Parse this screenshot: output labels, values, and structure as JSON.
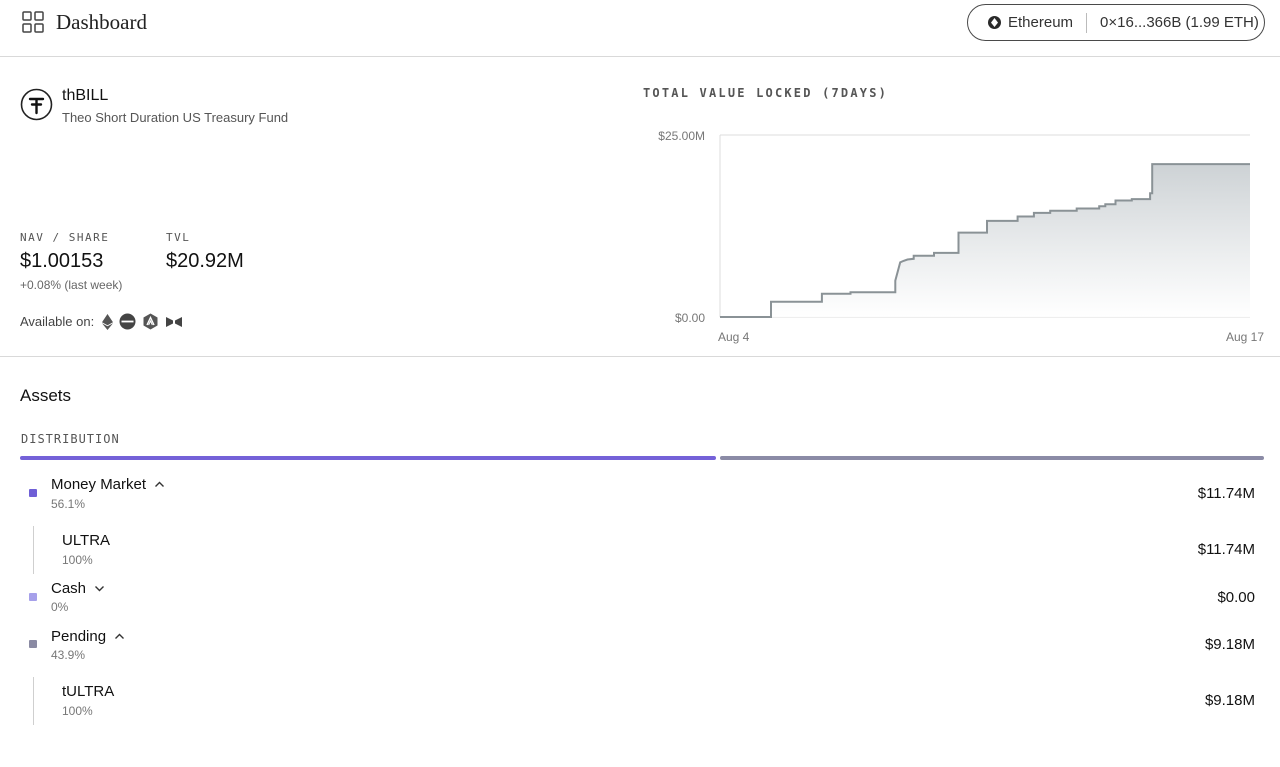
{
  "header": {
    "title": "Dashboard",
    "network": "Ethereum",
    "address": "0×16...366B (1.99 ETH)"
  },
  "fund": {
    "symbol": "thBILL",
    "name": "Theo Short Duration US Treasury Fund",
    "nav_label": "NAV / SHARE",
    "nav_value": "$1.00153",
    "nav_change": "+0.08% (last week)",
    "tvl_label": "TVL",
    "tvl_value": "$20.92M",
    "available_label": "Available on:",
    "available_icons": [
      "ethereum-icon",
      "chain-icon-circle",
      "arbitrum-icon",
      "chain-icon-bowtie"
    ]
  },
  "chart_data": {
    "type": "area",
    "title": "TOTAL VALUE LOCKED (7DAYS)",
    "y_tick_labels": [
      "$25.00M",
      "$0.00"
    ],
    "x_tick_labels": [
      "Aug 4",
      "Aug 17"
    ],
    "ylim": [
      0,
      25
    ],
    "x_range": [
      4,
      17
    ],
    "line_color": "#8a9296",
    "x": [
      4,
      5.25,
      5.25,
      6.5,
      6.5,
      7.2,
      7.2,
      8.3,
      8.3,
      8.42,
      8.5,
      8.6,
      8.75,
      8.75,
      9.25,
      9.25,
      9.85,
      9.85,
      10.55,
      10.55,
      11.3,
      11.3,
      11.7,
      11.7,
      12.1,
      12.1,
      12.75,
      12.75,
      13.3,
      13.3,
      13.45,
      13.45,
      13.7,
      13.7,
      14.1,
      14.1,
      14.55,
      14.55,
      14.6,
      14.6,
      17
    ],
    "y": [
      0,
      0,
      2.1,
      2.1,
      3.2,
      3.2,
      3.4,
      3.4,
      5.0,
      7.5,
      7.7,
      7.9,
      8.0,
      8.4,
      8.4,
      8.8,
      8.8,
      11.6,
      11.6,
      13.2,
      13.2,
      13.8,
      13.8,
      14.3,
      14.3,
      14.6,
      14.6,
      14.9,
      14.9,
      15.2,
      15.2,
      15.5,
      15.5,
      16.0,
      16.0,
      16.2,
      16.2,
      17.0,
      17.0,
      21.0,
      21.0
    ]
  },
  "assets": {
    "title": "Assets",
    "distribution_label": "DISTRIBUTION",
    "distribution_bar": [
      {
        "name": "Money Market",
        "percent": 56.1,
        "color": "#7461d8"
      },
      {
        "name": "Pending",
        "percent": 43.9,
        "color": "#8b8ba6"
      }
    ],
    "rows": [
      {
        "name": "Money Market",
        "pct": "56.1%",
        "value": "$11.74M",
        "color": "#6f5fd6",
        "expanded": true
      },
      {
        "name": "ULTRA",
        "pct": "100%",
        "value": "$11.74M"
      },
      {
        "name": "Cash",
        "pct": "0%",
        "value": "$0.00",
        "color": "#a6a0ea",
        "expanded": false
      },
      {
        "name": "Pending",
        "pct": "43.9%",
        "value": "$9.18M",
        "color": "#8a8aa3",
        "expanded": true
      },
      {
        "name": "tULTRA",
        "pct": "100%",
        "value": "$9.18M"
      }
    ]
  }
}
